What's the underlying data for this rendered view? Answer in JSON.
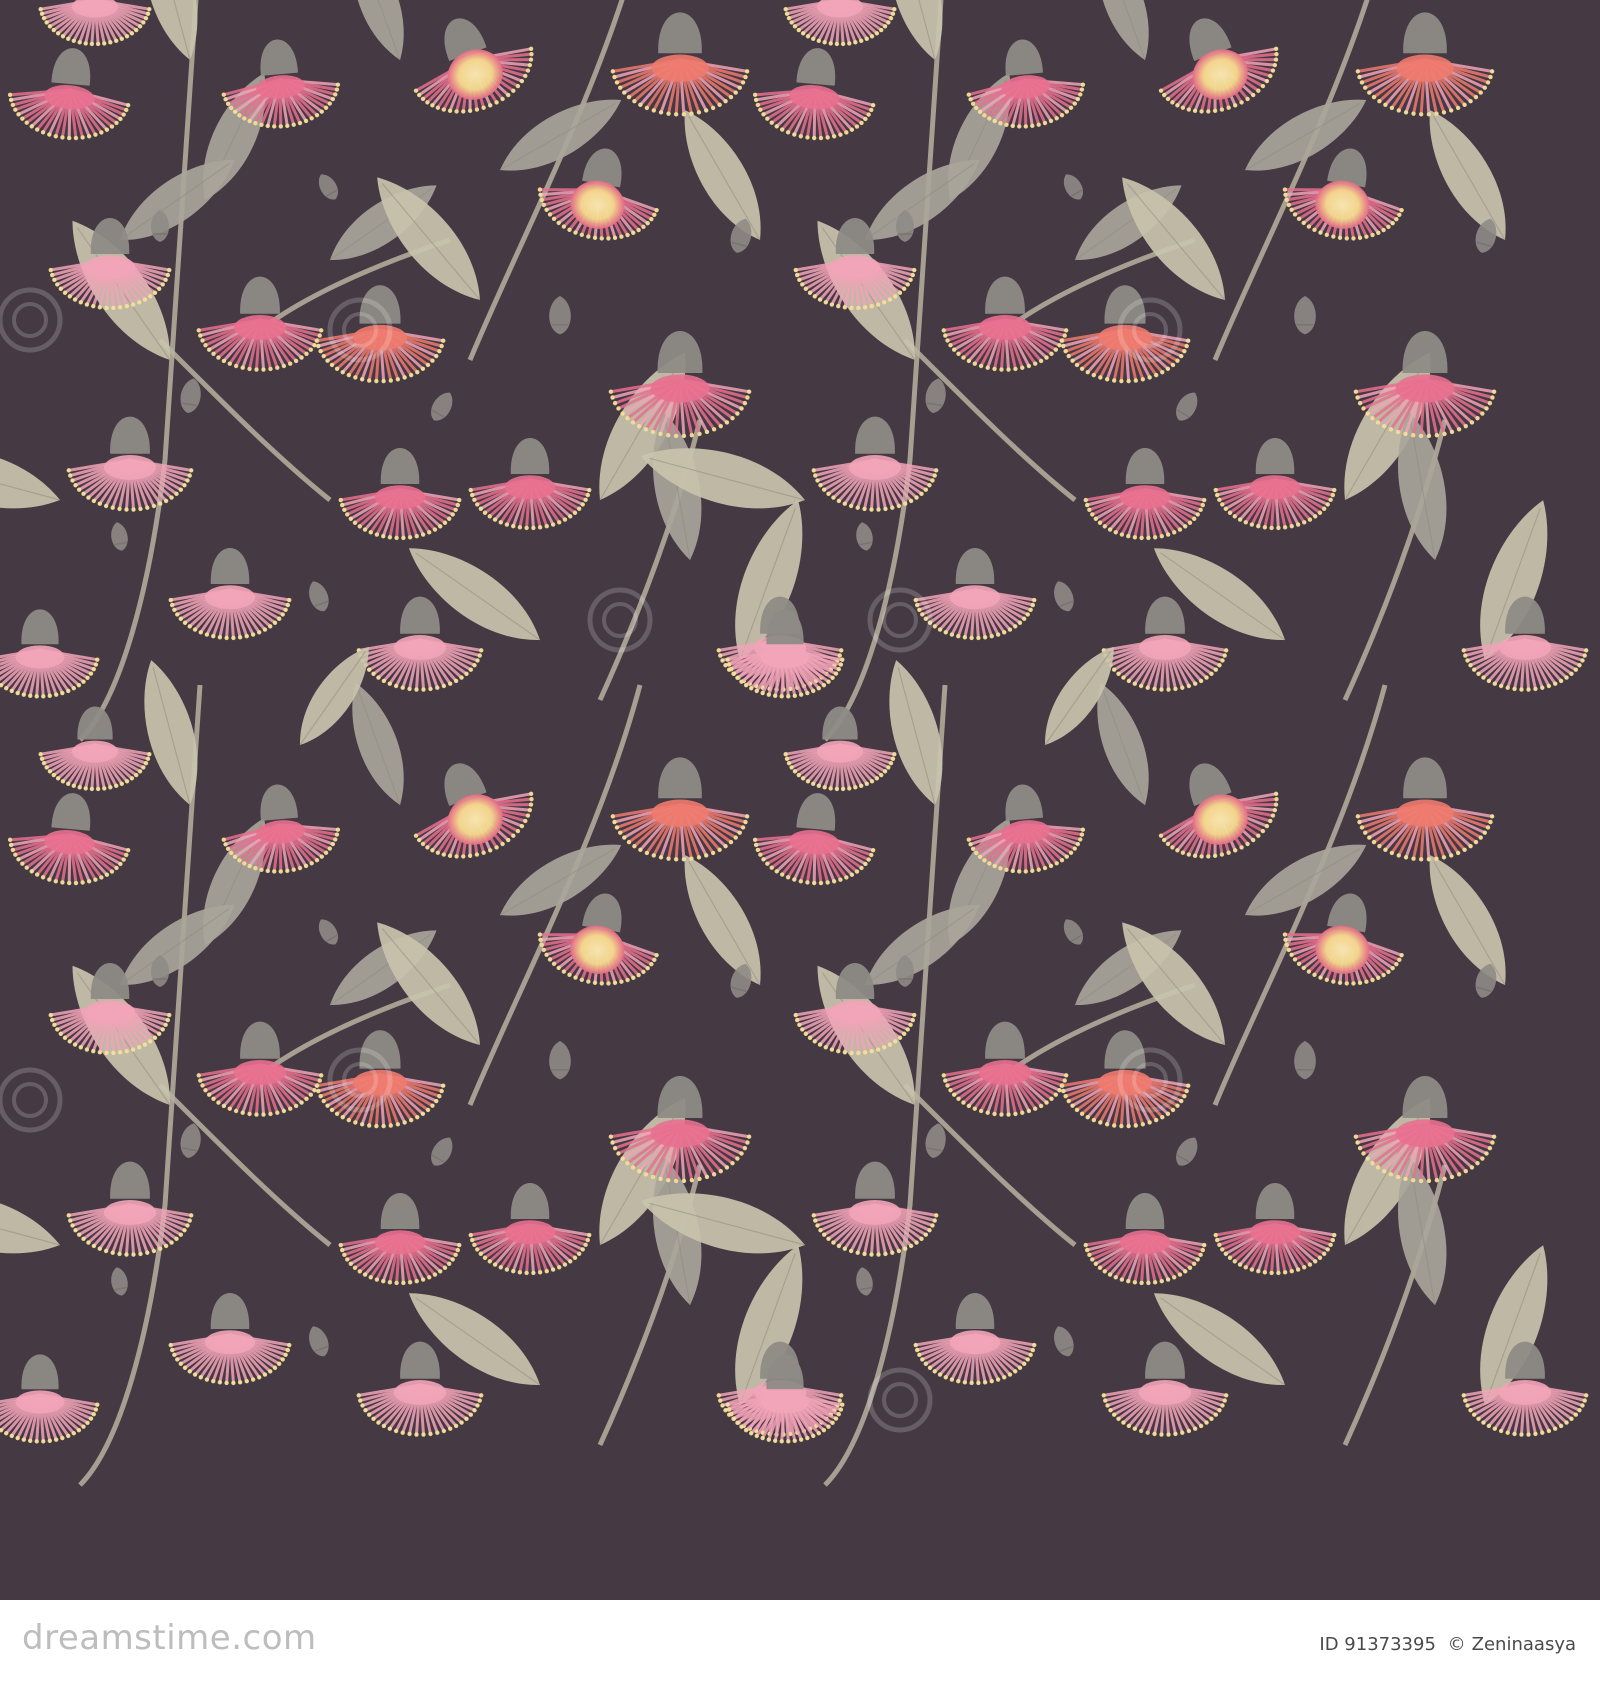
{
  "artwork": {
    "palette": {
      "background": "#453943",
      "petal_pink": "#e8708f",
      "petal_light": "#f2a4b8",
      "petal_coral": "#ee7a6e",
      "stamen_yellow": "#f3e39a",
      "leaf_sage": "#c9c3ad",
      "leaf_grey": "#a9a59a",
      "bud_grey": "#8e8b86",
      "stem": "#b9b1a0"
    },
    "watermark": "dreamstime"
  },
  "footer": {
    "logo": "dreamstime.com",
    "id_label": "ID",
    "id_value": "91373395",
    "copyright_symbol": "©",
    "author": "Zeninaasya"
  }
}
